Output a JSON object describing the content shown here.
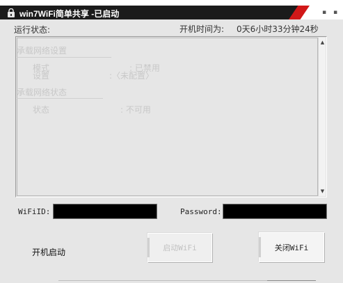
{
  "window": {
    "title": "win7WiFi简单共享 -已启动",
    "controls": {
      "minimize": "▪",
      "close": "▪"
    }
  },
  "status_row": {
    "label": "运行状态:",
    "uptime_label": "开机时间为:",
    "uptime_value": "0天6小时33分钟24秒"
  },
  "log": {
    "section1_title": "承载网络设置",
    "mode_label": "模式",
    "mode_value": ": 已禁用",
    "settings_label": "设置",
    "settings_value": ":〈未配置〉",
    "section2_title": "承载网络状态",
    "state_label": "状态",
    "state_value": ": 不可用",
    "scroll_up": "▲",
    "scroll_down": "▼"
  },
  "form": {
    "wifi_id_label": "WiFiID:",
    "wifi_id_value": "",
    "password_label": "Password:",
    "password_value": ""
  },
  "actions": {
    "autostart_label": "开机启动",
    "start_wifi": "启动WiFi",
    "stop_wifi": "关闭WiFi"
  },
  "colors": {
    "title_bar": "#1b1b1b",
    "accent_red": "#d11818",
    "input_bg": "#000000"
  }
}
